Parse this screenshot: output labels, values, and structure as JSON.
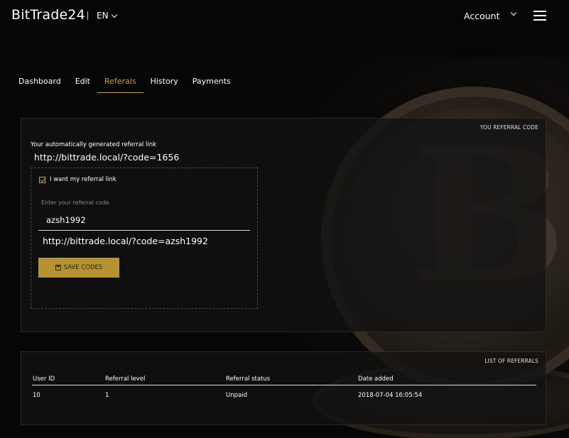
{
  "header": {
    "logo": "BitTrade24",
    "language": "EN",
    "account_label": "Account"
  },
  "tabs": [
    {
      "label": "Dashboard",
      "active": false
    },
    {
      "label": "Edit",
      "active": false
    },
    {
      "label": "Referals",
      "active": true
    },
    {
      "label": "History",
      "active": false
    },
    {
      "label": "Payments",
      "active": false
    }
  ],
  "referral_code": {
    "section_title": "YOU REFERRAL CODE",
    "generated_label": "Your automatically generated referral link",
    "generated_link": "http://bittrade.local/?code=1656",
    "checkbox_label": "I want my referral link",
    "checkbox_checked": true,
    "input_placeholder": "Enter your referral code",
    "input_value": "azsh1992",
    "custom_link": "http://bittrade.local/?code=azsh1992",
    "save_label": "SAVE CODES"
  },
  "referrals": {
    "section_title": "LIST OF REFERRALS",
    "columns": [
      "User ID",
      "Referral level",
      "Referral status",
      "Date added"
    ],
    "rows": [
      [
        "10",
        "1",
        "Unpaid",
        "2018-07-04 16:05:54"
      ]
    ]
  },
  "colors": {
    "accent": "#c9a44a",
    "button": "#b69332",
    "background": "#060606"
  }
}
